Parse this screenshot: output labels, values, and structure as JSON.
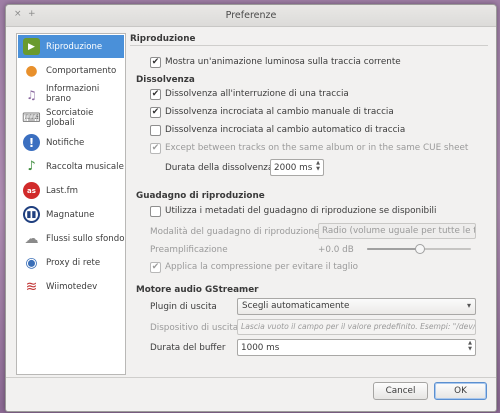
{
  "window": {
    "title": "Preferenze",
    "close_glyph": "×",
    "maximize_glyph": "+"
  },
  "sidebar": {
    "items": [
      {
        "label": "Riproduzione",
        "icon": "play-icon",
        "glyph": "▶",
        "color": "#6a9a2e",
        "selected": true
      },
      {
        "label": "Comportamento",
        "icon": "behaviour-icon",
        "glyph": "●",
        "color": "#e8902c"
      },
      {
        "label": "Informazioni\nbrano",
        "icon": "song-info-icon",
        "glyph": "♫",
        "color": "#8a6aa0"
      },
      {
        "label": "Scorciatoie\nglobali",
        "icon": "keyboard-icon",
        "glyph": "⌨",
        "color": "#7a7a7a"
      },
      {
        "label": "Notifiche",
        "icon": "notification-icon",
        "glyph": "!",
        "color": "#3b6fc0"
      },
      {
        "label": "Raccolta musicale",
        "icon": "library-icon",
        "glyph": "♪",
        "color": "#3b8a3b"
      },
      {
        "label": "Last.fm",
        "icon": "lastfm-icon",
        "glyph": "as",
        "color": "#d12a2a"
      },
      {
        "label": "Magnatune",
        "icon": "magnatune-icon",
        "glyph": "▮▮",
        "color": "#1f3f7f"
      },
      {
        "label": "Flussi sullo sfondo",
        "icon": "cloud-icon",
        "glyph": "☁",
        "color": "#8a8a8a"
      },
      {
        "label": "Proxy di rete",
        "icon": "globe-icon",
        "glyph": "◉",
        "color": "#3a6fb8"
      },
      {
        "label": "Wiimotedev",
        "icon": "wiimote-icon",
        "glyph": "≋",
        "color": "#c03030"
      }
    ]
  },
  "panel": {
    "header": "Riproduzione",
    "anim_checkbox": {
      "label": "Mostra un'animazione luminosa sulla traccia corrente",
      "checked": true
    },
    "fade": {
      "title": "Dissolvenza",
      "opt1": {
        "label": "Dissolvenza all'interruzione di una traccia",
        "checked": true
      },
      "opt2": {
        "label": "Dissolvenza incrociata al cambio manuale di traccia",
        "checked": true
      },
      "opt3": {
        "label": "Dissolvenza incrociata al cambio automatico di traccia",
        "checked": false
      },
      "opt4": {
        "label": "Except between tracks on the same album or in the same CUE sheet",
        "checked": true,
        "disabled": true
      },
      "duration_label": "Durata della dissolvenza",
      "duration_value": "2000 ms"
    },
    "gain": {
      "title": "Guadagno di riproduzione",
      "use_meta": {
        "label": "Utilizza i metadati del guadagno di riproduzione se disponibili",
        "checked": false
      },
      "mode_label": "Modalità del guadagno di riproduzione",
      "mode_value": "Radio (volume uguale per tutte le t",
      "preamp_label": "Preamplificazione",
      "preamp_value": "+0.0 dB",
      "preamp_position": 0.5,
      "compress": {
        "label": "Applica la compressione per evitare il taglio",
        "checked": true
      }
    },
    "engine": {
      "title": "Motore audio GStreamer",
      "plugin_label": "Plugin di uscita",
      "plugin_value": "Scegli automaticamente",
      "device_label": "Dispositivo di uscita",
      "device_placeholder": "Lascia vuoto il campo per il valore predefinito. Esempi: \"/dev/dsp\",",
      "buffer_label": "Durata del buffer",
      "buffer_value": "1000 ms"
    }
  },
  "footer": {
    "cancel_label": "Cancel",
    "ok_label": "OK"
  },
  "glyphs": {
    "check": "✔",
    "dropdown_arrow": "▾",
    "spin_up": "▲",
    "spin_down": "▼"
  }
}
